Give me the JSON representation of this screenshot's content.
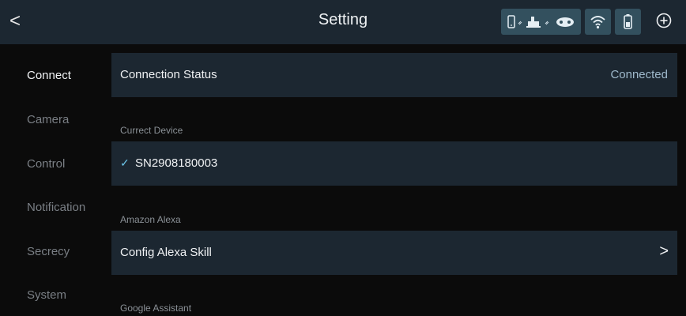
{
  "header": {
    "back_label": "<",
    "title": "Setting"
  },
  "sidebar": {
    "items": [
      {
        "label": "Connect",
        "active": true
      },
      {
        "label": "Camera",
        "active": false
      },
      {
        "label": "Control",
        "active": false
      },
      {
        "label": "Notification",
        "active": false
      },
      {
        "label": "Secrecy",
        "active": false
      },
      {
        "label": "System",
        "active": false
      }
    ]
  },
  "connection": {
    "label": "Connection Status",
    "value": "Connected"
  },
  "current_device": {
    "section_label": "Currect Device",
    "serial": "SN2908180003",
    "check_glyph": "✓"
  },
  "alexa": {
    "section_label": "Amazon Alexa",
    "label": "Config Alexa Skill",
    "chevron": ">"
  },
  "google": {
    "section_label": "Google Assistant"
  },
  "colors": {
    "bar_bg": "#1c2731",
    "status_box_bg": "#33505e",
    "accent": "#6cc5e8",
    "connected_text": "#9fb9cc"
  },
  "icons": {
    "back": "chevron-left-icon",
    "devices": "phone-robot-gamepad-icon",
    "wifi": "wifi-icon",
    "battery": "battery-icon",
    "add": "add-circle-icon"
  }
}
